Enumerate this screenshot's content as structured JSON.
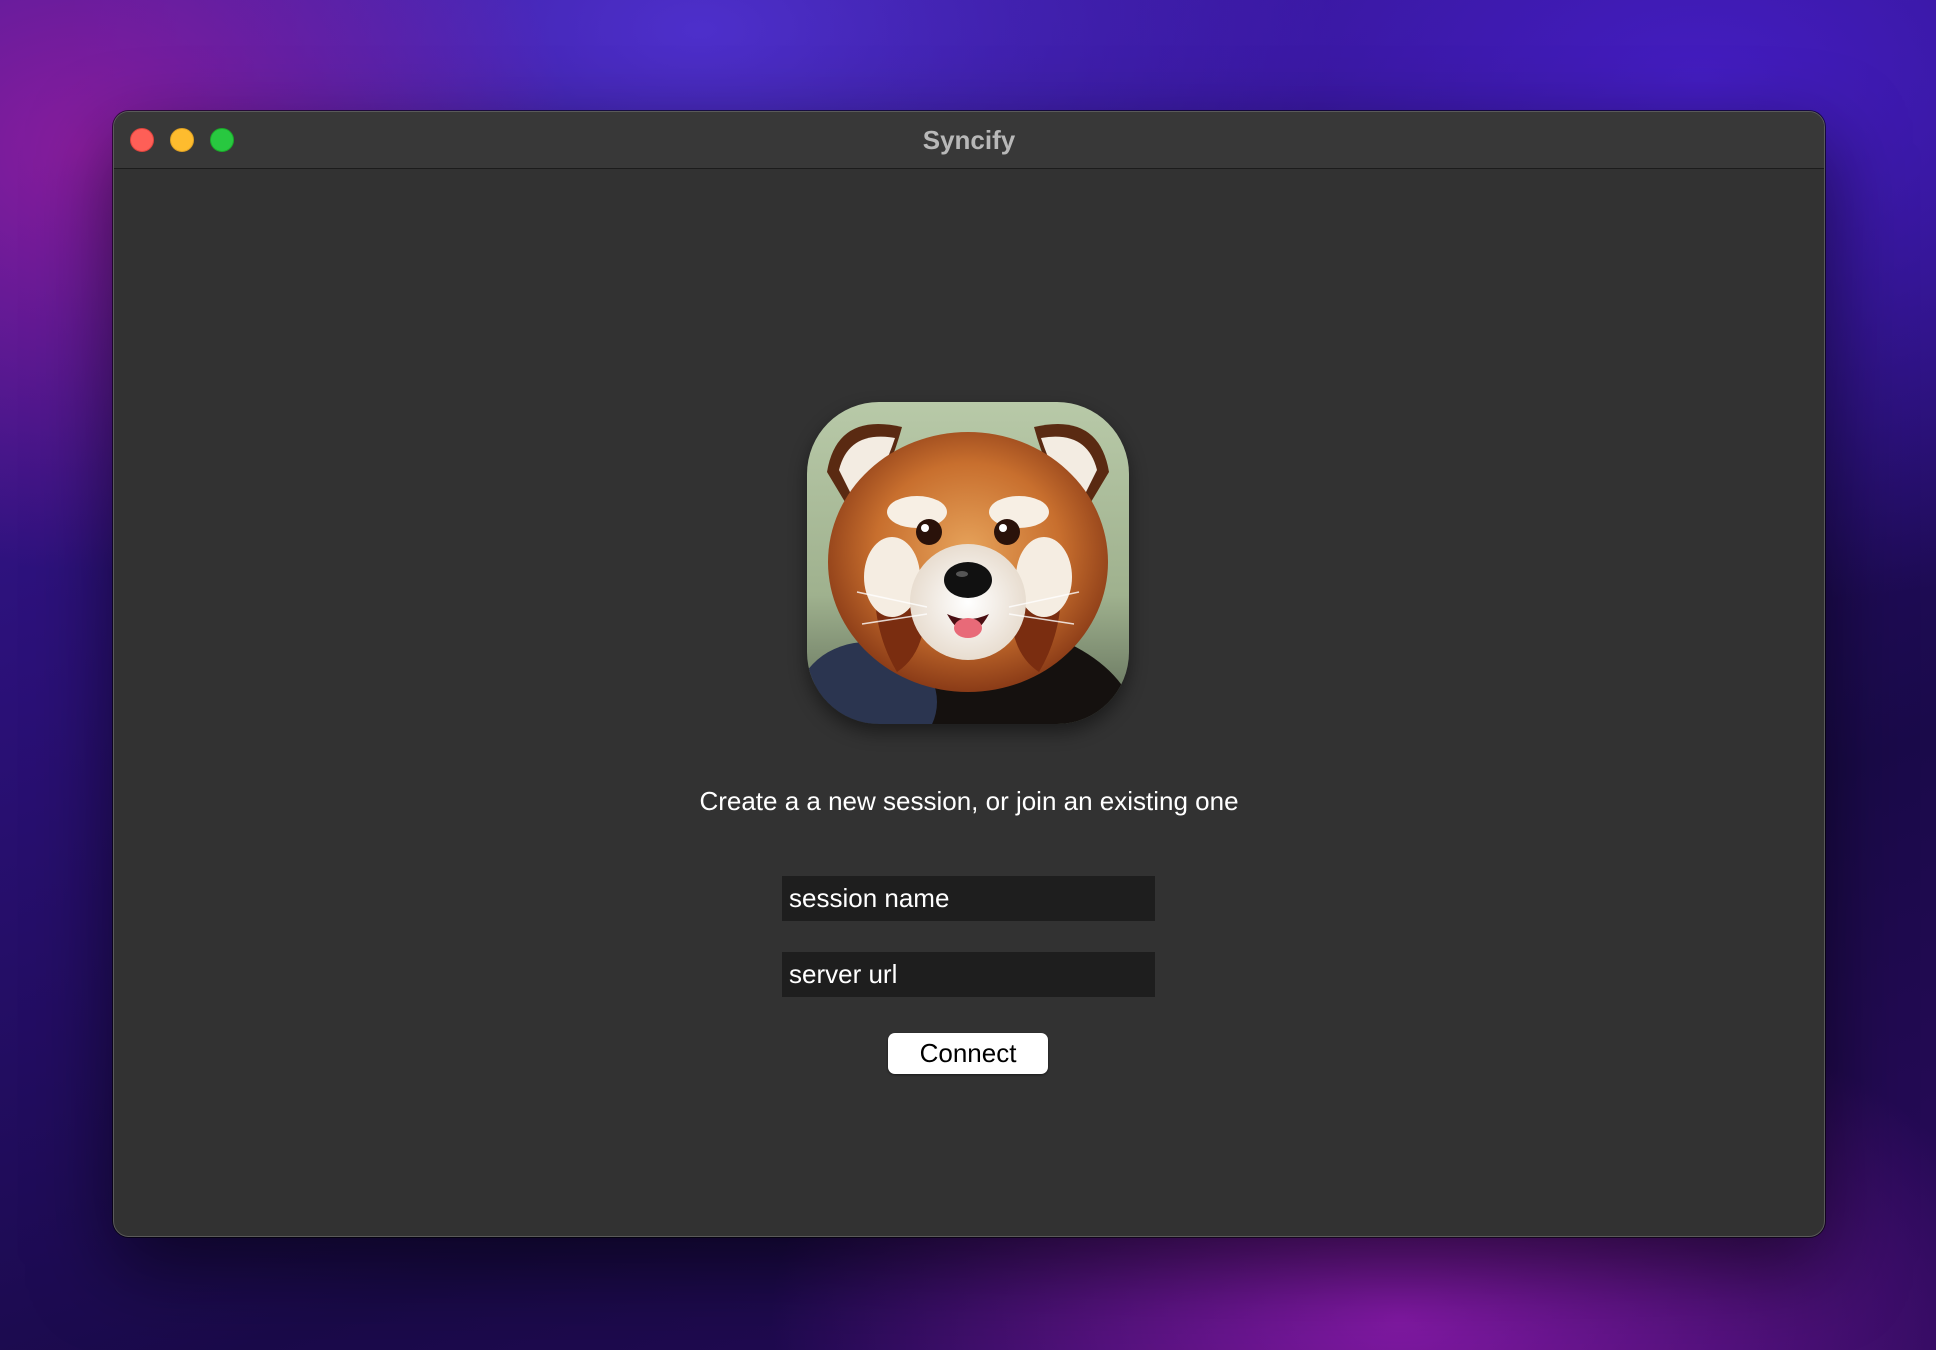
{
  "window": {
    "title": "Syncify"
  },
  "app_icon": {
    "icon": "red-panda-icon"
  },
  "main": {
    "prompt": "Create a a new session, or join an existing one",
    "session_field": {
      "value": "",
      "placeholder": "session name"
    },
    "server_field": {
      "value": "",
      "placeholder": "server url"
    },
    "connect_label": "Connect"
  },
  "colors": {
    "window_bg": "#323232",
    "titlebar_bg": "#383838",
    "field_bg": "#1e1e1e",
    "close": "#fe5f57",
    "minimize": "#febc2e",
    "zoom": "#28c840"
  }
}
